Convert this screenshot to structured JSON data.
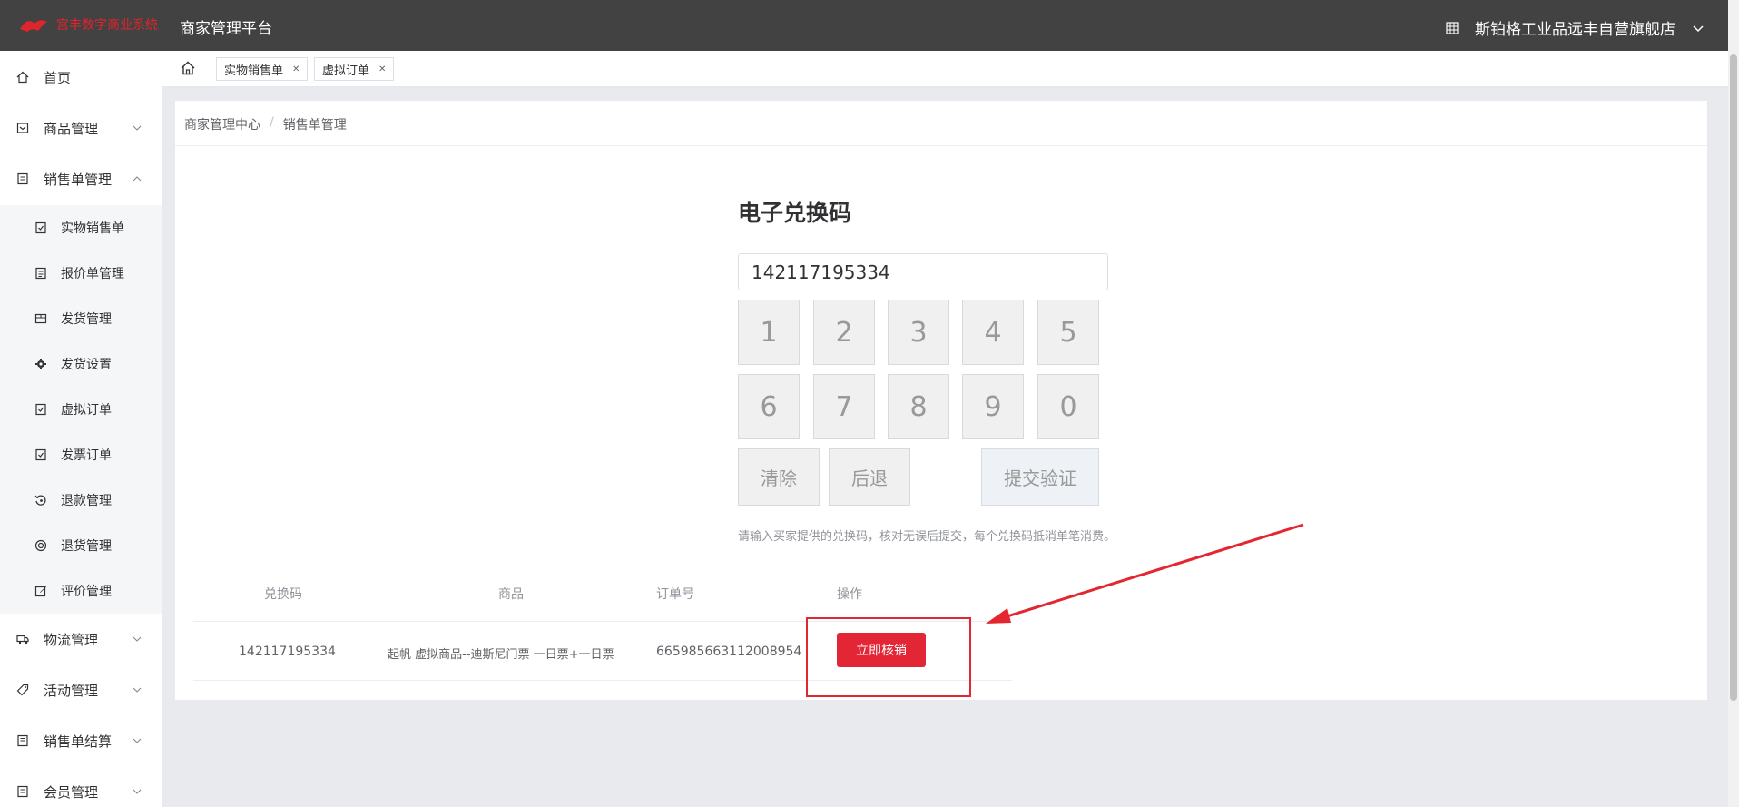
{
  "header": {
    "logo_text": "宫丰数字商业系统",
    "platform_title": "商家管理平台",
    "store_name": "斯铂格工业品远丰自营旗舰店"
  },
  "sidebar": {
    "items": [
      {
        "label": "首页",
        "icon": "home-icon"
      },
      {
        "label": "商品管理",
        "icon": "goods-icon",
        "expanded": false
      },
      {
        "label": "销售单管理",
        "icon": "order-icon",
        "expanded": true
      }
    ],
    "sub_items": [
      {
        "label": "实物销售单",
        "icon": "doc-check-icon"
      },
      {
        "label": "报价单管理",
        "icon": "doc-icon"
      },
      {
        "label": "发货管理",
        "icon": "box-icon"
      },
      {
        "label": "发货设置",
        "icon": "gear-icon"
      },
      {
        "label": "虚拟订单",
        "icon": "doc-check-icon"
      },
      {
        "label": "发票订单",
        "icon": "doc-check-icon"
      },
      {
        "label": "退款管理",
        "icon": "refund-icon"
      },
      {
        "label": "退货管理",
        "icon": "return-icon"
      },
      {
        "label": "评价管理",
        "icon": "edit-icon"
      }
    ],
    "more_items": [
      {
        "label": "物流管理",
        "icon": "truck-icon"
      },
      {
        "label": "活动管理",
        "icon": "tag-icon"
      },
      {
        "label": "销售单结算",
        "icon": "settle-icon"
      },
      {
        "label": "会员管理",
        "icon": "member-icon"
      }
    ]
  },
  "tabs": [
    {
      "label": "实物销售单"
    },
    {
      "label": "虚拟订单"
    }
  ],
  "breadcrumb": [
    "商家管理中心",
    "销售单管理"
  ],
  "redeem": {
    "title": "电子兑换码",
    "code_value": "142117195334",
    "keys": [
      "1",
      "2",
      "3",
      "4",
      "5",
      "6",
      "7",
      "8",
      "9",
      "0"
    ],
    "clear_label": "清除",
    "back_label": "后退",
    "submit_label": "提交验证",
    "hint": "请输入买家提供的兑换码，核对无误后提交，每个兑换码抵消单笔消费。"
  },
  "table": {
    "headers": [
      "兑换码",
      "商品",
      "订单号",
      "操作"
    ],
    "rows": [
      {
        "code": "142117195334",
        "product": "起帆 虚拟商品--迪斯尼门票 一日票+一日票",
        "order_no": "665985663112008954",
        "action": "立即核销"
      }
    ]
  },
  "colors": {
    "header_bg": "#424242",
    "accent_red": "#e32636",
    "annotation_red": "#e3262f"
  }
}
